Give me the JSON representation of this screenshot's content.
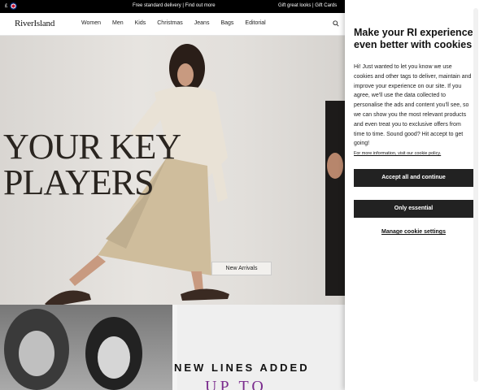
{
  "topbar": {
    "currency": "£",
    "promo": "Free standard delivery | Find out more",
    "gifts": "Gift great looks | Gift Cards"
  },
  "header": {
    "logo": "RiverIsland",
    "nav": [
      "Women",
      "Men",
      "Kids",
      "Christmas",
      "Jeans",
      "Bags",
      "Editorial"
    ],
    "search_icon": "search-icon"
  },
  "hero": {
    "headline_line1": "YOUR KEY",
    "headline_line2": "PLAYERS",
    "cta": "New Arrivals"
  },
  "lower": {
    "title": "NEW LINES ADDED",
    "subtitle": "UP TO"
  },
  "cookie": {
    "title": "Make your RI experience even better with cookies",
    "body": "Hi! Just wanted to let you know we use cookies and other tags to deliver, maintain and improve your experience on our site. If you agree, we'll use the data collected to personalise the ads and content you'll see, so we can show you the most relevant products and even treat you to exclusive offers from time to time. Sound good? Hit accept to get going!",
    "policy_link": "For more information, visit our cookie policy.",
    "accept_label": "Accept all and continue",
    "essential_label": "Only essential",
    "manage_label": "Manage cookie settings"
  }
}
